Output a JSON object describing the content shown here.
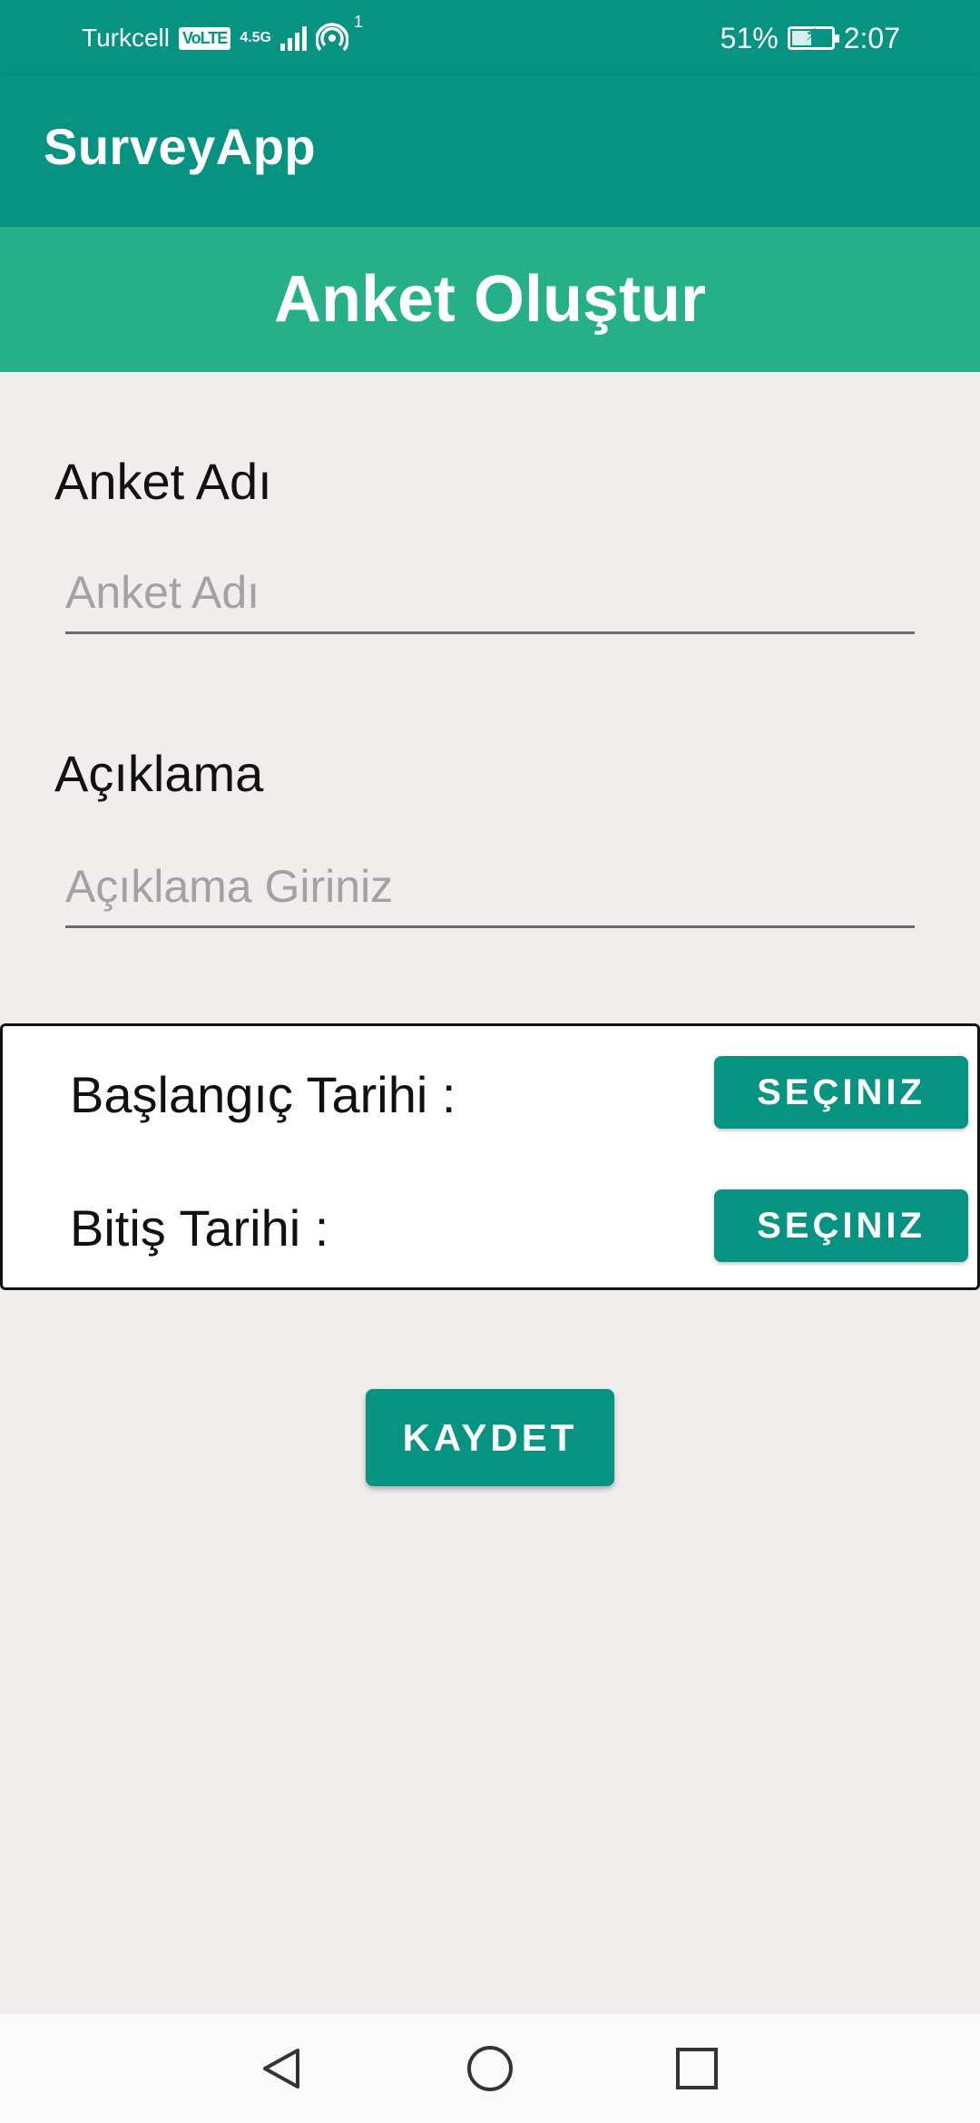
{
  "status_bar": {
    "carrier": "Turkcell",
    "volte": "VoLTE",
    "network": "4.5G",
    "hotspot_count": "1",
    "battery_percent": "51%",
    "battery_level": 0.51,
    "time": "2:07"
  },
  "app_bar": {
    "title": "SurveyApp"
  },
  "header": {
    "title": "Anket Oluştur"
  },
  "form": {
    "name_label": "Anket Adı",
    "name_placeholder": "Anket Adı",
    "name_value": "",
    "description_label": "Açıklama",
    "description_placeholder": "Açıklama Giriniz",
    "description_value": "",
    "start_date_label": "Başlangıç Tarihi :",
    "start_date_button": "SEÇINIZ",
    "end_date_label": "Bitiş Tarihi :",
    "end_date_button": "SEÇINIZ",
    "save_button": "KAYDET"
  },
  "nav": {
    "back": "back-icon",
    "home": "home-icon",
    "recents": "recents-icon"
  },
  "colors": {
    "primary": "#069381",
    "header": "#25b088",
    "background": "#f2eded"
  }
}
